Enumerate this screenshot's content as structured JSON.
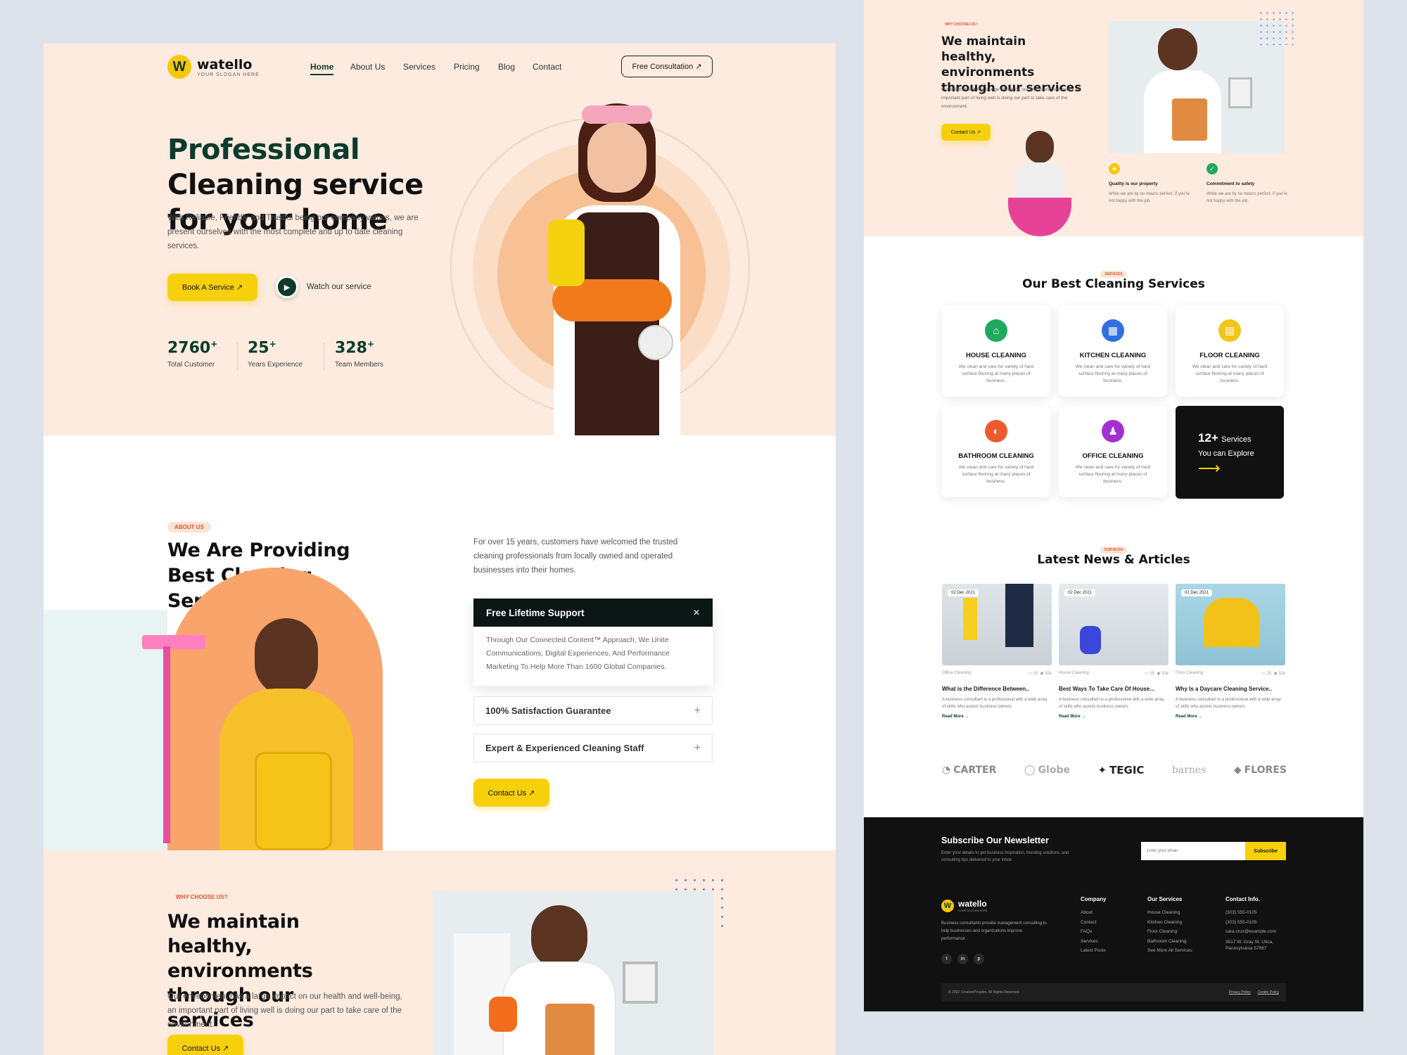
{
  "brand": {
    "name": "watello",
    "slogan": "YOUR SLOGAN HERE"
  },
  "nav": {
    "items": [
      "Home",
      "About Us",
      "Services",
      "Pricing",
      "Blog",
      "Contact"
    ],
    "cta": "Free Consultation ↗"
  },
  "hero": {
    "title_green": "Professional",
    "title_rest": "Cleaning service for your home",
    "description": "With Reliable, Friendly and Trustful being our company values, we are present ourselves with the most complete and up to date cleaning services.",
    "book_btn": "Book A Service ↗",
    "watch": "Watch our service",
    "stats": [
      {
        "num": "2760",
        "label": "Total Customer"
      },
      {
        "num": "25",
        "label": "Years Experience"
      },
      {
        "num": "328",
        "label": "Team Members"
      }
    ]
  },
  "about": {
    "tag": "ABOUT US",
    "title": "We Are Providing Best Cleaning Services",
    "text": "For over 15 years, customers have welcomed the trusted cleaning professionals from locally owned and operated businesses into their homes.",
    "accordion": [
      {
        "title": "Free Lifetime Support",
        "body": "Through Our Connected Content™ Approach, We Unite Communications, Digital Experiences, And Performance Marketing To Help More Than 1600 Global Companies.",
        "open": true
      },
      {
        "title": "100% Satisfaction Guarantee",
        "open": false
      },
      {
        "title": "Expert & Experienced Cleaning Staff",
        "open": false
      }
    ],
    "contact_btn": "Contact Us ↗"
  },
  "why": {
    "tag": "WHY CHOOSE US?",
    "title": "We maintain healthy, environments through our services",
    "text": "Our environment has a large impact on our health and well-being, an important part of living well is doing our part to take care of the environment.",
    "btn": "Contact Us ↗",
    "features": [
      {
        "title": "Quality is our property",
        "text": "While we are by no means perfect, if you're not happy with the job."
      },
      {
        "title": "Commitment to safety",
        "text": "While we are by no means perfect, if you're not happy with the job."
      }
    ]
  },
  "services": {
    "tag": "SERVICES",
    "title": "Our Best Cleaning Services",
    "desc": "We clean and care for variety of hard surface flooring at many places of business.",
    "items": [
      {
        "name": "HOUSE CLEANING",
        "color": "#1eaa5d"
      },
      {
        "name": "KITCHEN CLEANING",
        "color": "#2f6fe0"
      },
      {
        "name": "FLOOR CLEANING",
        "color": "#f2c51a"
      },
      {
        "name": "BATHROOM CLEANING",
        "color": "#ec5a2c"
      },
      {
        "name": "OFFICE CLEANING",
        "color": "#a32fd0"
      }
    ],
    "more_num": "12+",
    "more_label": "Services",
    "more_sub": "You can Explore"
  },
  "blog": {
    "tag": "OUR BLOG",
    "title": "Latest News & Articles",
    "posts": [
      {
        "date": "02 Dec 2021",
        "cat": "Office Cleaning",
        "comments": "25",
        "views": "32k",
        "title": "What is the Difference Between..",
        "excerpt": "A business consultant is a professional with a wide array of skills who assists business owners",
        "more": "Read More →"
      },
      {
        "date": "02 Dec 2021",
        "cat": "House Cleaning",
        "comments": "25",
        "views": "32k",
        "title": "Best Ways To Take Care Of House...",
        "excerpt": "A business consultant is a professional with a wide array of skills who assists business owners",
        "more": "Read More →"
      },
      {
        "date": "02 Dec 2021",
        "cat": "Floor Cleaning",
        "comments": "25",
        "views": "32k",
        "title": "Why Is a Daycare Cleaning Service..",
        "excerpt": "A business consultant is a professional with a wide array of skills who assists business owners",
        "more": "Read More →"
      }
    ]
  },
  "partners": [
    "CARTER",
    "Globe",
    "TEGIC",
    "barnes",
    "FLORES"
  ],
  "newsletter": {
    "title": "Subscribe Our Newsletter",
    "text": "Enter your details to get business inspiration, trending solutions, and consulting tips delivered to your inbox",
    "placeholder": "Enter your email",
    "btn": "Subscribe"
  },
  "footer": {
    "about": "Business consultants provide management consulting to help businesses and organizations improve performance .",
    "company": {
      "title": "Company",
      "links": [
        "About",
        "Contact",
        "FAQs",
        "Services",
        "Latest Posts"
      ]
    },
    "services": {
      "title": "Our Services",
      "links": [
        "House Cleaning",
        "Kitchen Cleaning",
        "Floor Cleaning",
        "Bathroom Cleaning",
        "See More All Services"
      ]
    },
    "contact": {
      "title": "Contact Info.",
      "lines": [
        "(303) 555-0105",
        "(303) 555-0105",
        "sara.cruz@example.com",
        "3517 W. Gray St. Utica,",
        "Pennsylvania 57867"
      ]
    },
    "copyright": "© 2022 CreativePeoples. All Rights Reserved",
    "legal": [
      "Privacy Policy",
      "Cookie Policy"
    ]
  },
  "colors": {
    "dark_green": "#0b3b2c",
    "yellow": "#f7d00c",
    "peach": "#fdebe0",
    "orange": "#e0522a"
  }
}
